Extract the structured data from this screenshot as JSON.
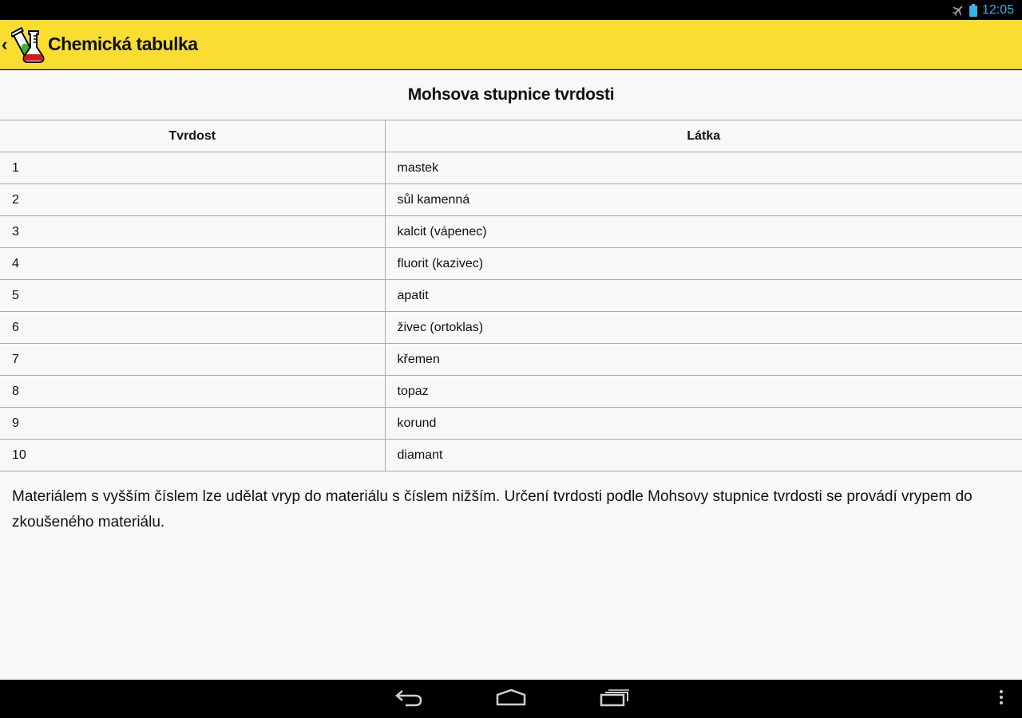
{
  "status_bar": {
    "time": "12:05",
    "icons": [
      "airplane-mode-icon",
      "battery-icon"
    ],
    "accent_color": "#33b5e5"
  },
  "action_bar": {
    "title": "Chemická tabulka",
    "up_icon": "chevron-left-icon",
    "app_icon": "test-tubes-icon",
    "background_color": "#f9de31"
  },
  "page": {
    "heading": "Mohsova stupnice tvrdosti",
    "table": {
      "headers": [
        "Tvrdost",
        "Látka"
      ],
      "rows": [
        [
          "1",
          "mastek"
        ],
        [
          "2",
          "sůl kamenná"
        ],
        [
          "3",
          "kalcit (vápenec)"
        ],
        [
          "4",
          "fluorit (kazivec)"
        ],
        [
          "5",
          "apatit"
        ],
        [
          "6",
          "živec (ortoklas)"
        ],
        [
          "7",
          "křemen"
        ],
        [
          "8",
          "topaz"
        ],
        [
          "9",
          "korund"
        ],
        [
          "10",
          "diamant"
        ]
      ]
    },
    "note": "Materiálem s vyšším číslem lze udělat vryp do materiálu s číslem nižším. Určení tvrdosti podle Mohsovy stupnice tvrdosti se provádí vrypem do zkoušeného materiálu."
  },
  "nav_bar": {
    "buttons": [
      "back-icon",
      "home-icon",
      "recents-icon",
      "overflow-menu-icon"
    ]
  }
}
